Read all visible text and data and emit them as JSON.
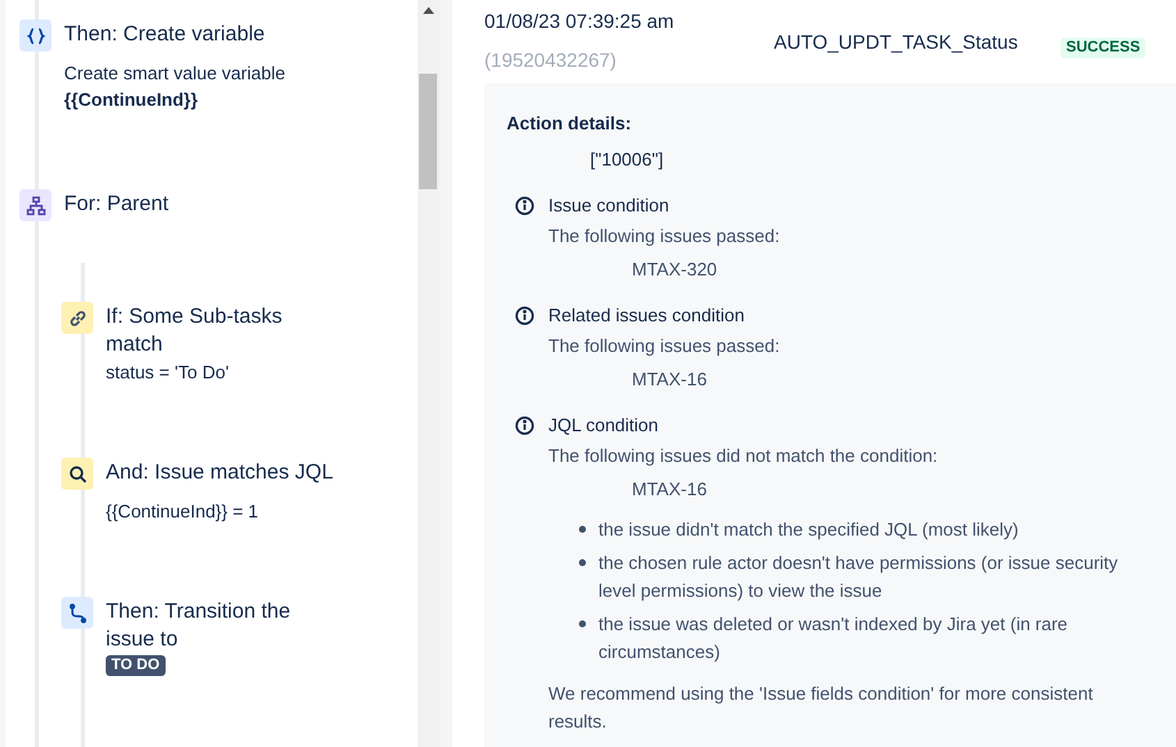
{
  "rule_steps": [
    {
      "kind": "variable",
      "title": "Then: Create variable",
      "description": "Create smart value variable",
      "value": "{{ContinueInd}}"
    },
    {
      "kind": "for",
      "title": "For: Parent",
      "children": [
        {
          "kind": "if",
          "title": "If: Some Sub-tasks match",
          "detail": "status = 'To Do'"
        },
        {
          "kind": "jql",
          "title": "And: Issue matches JQL",
          "detail": "{{ContinueInd}} = 1"
        },
        {
          "kind": "transition",
          "title": "Then: Transition the issue to",
          "status_lozenge": "TO DO"
        }
      ]
    }
  ],
  "audit_entry": {
    "timestamp": "01/08/23 07:39:25 am",
    "id": "(19520432267)",
    "rule": "AUTO_UPDT_TASK_Status",
    "status": "SUCCESS",
    "details": {
      "heading": "Action details:",
      "value": "[\"10006\"]",
      "conditions": [
        {
          "title": "Issue condition",
          "message": "The following issues passed:",
          "issues": [
            "MTAX-320"
          ]
        },
        {
          "title": "Related issues condition",
          "message": "The following issues passed:",
          "issues": [
            "MTAX-16"
          ]
        },
        {
          "title": "JQL condition",
          "message": "The following issues did not match the condition:",
          "issues": [
            "MTAX-16"
          ],
          "reasons": [
            "the issue didn't match the specified JQL (most likely)",
            "the chosen rule actor doesn't have permissions (or issue security level permissions) to view the issue",
            "the issue was deleted or wasn't indexed by Jira yet (in rare circumstances)"
          ],
          "recommendation": "We recommend using the 'Issue fields condition' for more consistent results."
        }
      ]
    }
  }
}
